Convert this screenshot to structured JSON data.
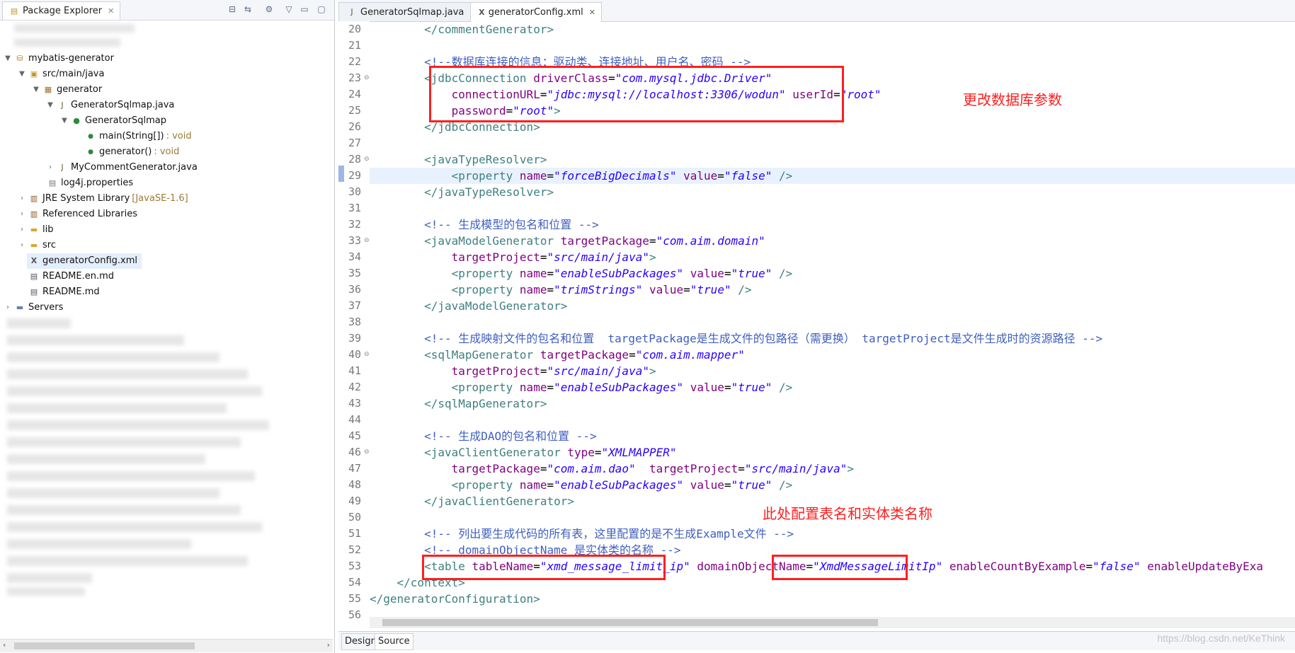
{
  "left_panel": {
    "tab_title": "Package Explorer",
    "tree": [
      {
        "label": "mybatis-generator",
        "icon": "project-icon"
      },
      {
        "label": "src/main/java",
        "icon": "source-folder-icon"
      },
      {
        "label": "generator",
        "icon": "package-icon"
      },
      {
        "label": "GeneratorSqlmap.java",
        "icon": "java-file-icon"
      },
      {
        "label": "GeneratorSqlmap",
        "icon": "class-icon"
      },
      {
        "label": "main(String[])",
        "suffix": " : void",
        "icon": "static-method-icon"
      },
      {
        "label": "generator()",
        "suffix": " : void",
        "icon": "method-icon"
      },
      {
        "label": "MyCommentGenerator.java",
        "icon": "java-file-icon"
      },
      {
        "label": "log4j.properties",
        "icon": "properties-file-icon"
      },
      {
        "label": "JRE System Library",
        "suffix": " [JavaSE-1.6]",
        "icon": "library-icon"
      },
      {
        "label": "Referenced Libraries",
        "icon": "library-icon"
      },
      {
        "label": "lib",
        "icon": "folder-icon"
      },
      {
        "label": "src",
        "icon": "folder-icon"
      },
      {
        "label": "generatorConfig.xml",
        "icon": "xml-file-icon"
      },
      {
        "label": "README.en.md",
        "icon": "md-file-icon"
      },
      {
        "label": "README.md",
        "icon": "md-file-icon"
      },
      {
        "label": "Servers",
        "icon": "folder-icon"
      }
    ]
  },
  "editor": {
    "tabs": [
      {
        "label": "GeneratorSqlmap.java",
        "icon": "java-file-icon"
      },
      {
        "label": "generatorConfig.xml",
        "icon": "xml-file-icon"
      }
    ],
    "annotations": {
      "db_note": "更改数据库参数",
      "table_note": "此处配置表名和实体类名称"
    },
    "bottom_tabs": {
      "design": "Design",
      "source": "Source"
    },
    "watermark": "https://blog.csdn.net/KeThink",
    "line_numbers": [
      "20",
      "21",
      "22",
      "23",
      "24",
      "25",
      "26",
      "27",
      "28",
      "29",
      "30",
      "31",
      "32",
      "33",
      "34",
      "35",
      "36",
      "37",
      "38",
      "39",
      "40",
      "41",
      "42",
      "43",
      "44",
      "45",
      "46",
      "47",
      "48",
      "49",
      "50",
      "51",
      "52",
      "53",
      "54",
      "55",
      "56"
    ],
    "lines": {
      "l20": {
        "t1": "        </commentGenerator>"
      },
      "l22": {
        "c1": "        <!--数据库连接的信息：驱动类、连接地址、用户名、密码 -->"
      },
      "l23": {
        "t1": "        <jdbcConnection ",
        "a1": "driverClass",
        "t2": "=",
        "v1": "\"com.mysql.jdbc.Driver\""
      },
      "l24": {
        "pre": "            ",
        "a1": "connectionURL",
        "t2": "=",
        "v1": "\"jdbc:mysql://localhost:3306/wodun\"",
        "sp": " ",
        "a2": "userId",
        "t3": "=",
        "v2": "\"root\""
      },
      "l25": {
        "pre": "            ",
        "a1": "password",
        "t2": "=",
        "v1": "\"root\"",
        "t3": ">"
      },
      "l26": {
        "t1": "        </jdbcConnection>"
      },
      "l28": {
        "t1": "        <javaTypeResolver>"
      },
      "l29": {
        "t1": "            <property ",
        "a1": "name",
        "t2": "=",
        "v1": "\"forceBigDecimals\"",
        "sp": " ",
        "a2": "value",
        "t3": "=",
        "v2": "\"false\"",
        "t4": " />"
      },
      "l30": {
        "t1": "        </javaTypeResolver>"
      },
      "l32": {
        "c1": "        <!-- 生成模型的包名和位置 -->"
      },
      "l33": {
        "t1": "        <javaModelGenerator ",
        "a1": "targetPackage",
        "t2": "=",
        "v1": "\"com.aim.domain\""
      },
      "l34": {
        "pre": "            ",
        "a1": "targetProject",
        "t2": "=",
        "v1": "\"src/main/java\"",
        "t3": ">"
      },
      "l35": {
        "t1": "            <property ",
        "a1": "name",
        "t2": "=",
        "v1": "\"enableSubPackages\"",
        "sp": " ",
        "a2": "value",
        "t3": "=",
        "v2": "\"true\"",
        "t4": " />"
      },
      "l36": {
        "t1": "            <property ",
        "a1": "name",
        "t2": "=",
        "v1": "\"trimStrings\"",
        "sp": " ",
        "a2": "value",
        "t3": "=",
        "v2": "\"true\"",
        "t4": " />"
      },
      "l37": {
        "t1": "        </javaModelGenerator>"
      },
      "l39": {
        "c1": "        <!-- 生成映射文件的包名和位置  targetPackage是生成文件的包路径（需更换） targetProject是文件生成时的资源路径 -->"
      },
      "l40": {
        "t1": "        <sqlMapGenerator ",
        "a1": "targetPackage",
        "t2": "=",
        "v1": "\"com.aim.mapper\""
      },
      "l41": {
        "pre": "            ",
        "a1": "targetProject",
        "t2": "=",
        "v1": "\"src/main/java\"",
        "t3": ">"
      },
      "l42": {
        "t1": "            <property ",
        "a1": "name",
        "t2": "=",
        "v1": "\"enableSubPackages\"",
        "sp": " ",
        "a2": "value",
        "t3": "=",
        "v2": "\"true\"",
        "t4": " />"
      },
      "l43": {
        "t1": "        </sqlMapGenerator>"
      },
      "l45": {
        "c1": "        <!-- 生成DAO的包名和位置 -->"
      },
      "l46": {
        "t1": "        <javaClientGenerator ",
        "a1": "type",
        "t2": "=",
        "v1": "\"XMLMAPPER\""
      },
      "l47": {
        "pre": "            ",
        "a1": "targetPackage",
        "t2": "=",
        "v1": "\"com.aim.dao\"",
        "sp": "  ",
        "a2": "targetProject",
        "t3": "=",
        "v2": "\"src/main/java\"",
        "t4": ">"
      },
      "l48": {
        "t1": "            <property ",
        "a1": "name",
        "t2": "=",
        "v1": "\"enableSubPackages\"",
        "sp": " ",
        "a2": "value",
        "t3": "=",
        "v2": "\"true\"",
        "t4": " />"
      },
      "l49": {
        "t1": "        </javaClientGenerator>"
      },
      "l51": {
        "c1": "        <!-- 列出要生成代码的所有表，这里配置的是不生成Example文件 -->"
      },
      "l52": {
        "c1": "        <!-- domainObjectName 是实体类的名称 -->"
      },
      "l53": {
        "t1": "        <table ",
        "a1": "tableName",
        "t2": "=",
        "v1": "\"xmd_message_limit_ip\"",
        "sp": " ",
        "a2": "domainObjectName",
        "t3": "=",
        "v2": "\"XmdMessageLimitIp\"",
        "sp2": " ",
        "a3": "enableCountByExample",
        "t4": "=",
        "v3": "\"false\"",
        "sp3": " ",
        "a4": "enableUpdateByExa"
      },
      "l54": {
        "t1": "    </context>"
      },
      "l55": {
        "t1": "</generatorConfiguration>"
      }
    }
  }
}
